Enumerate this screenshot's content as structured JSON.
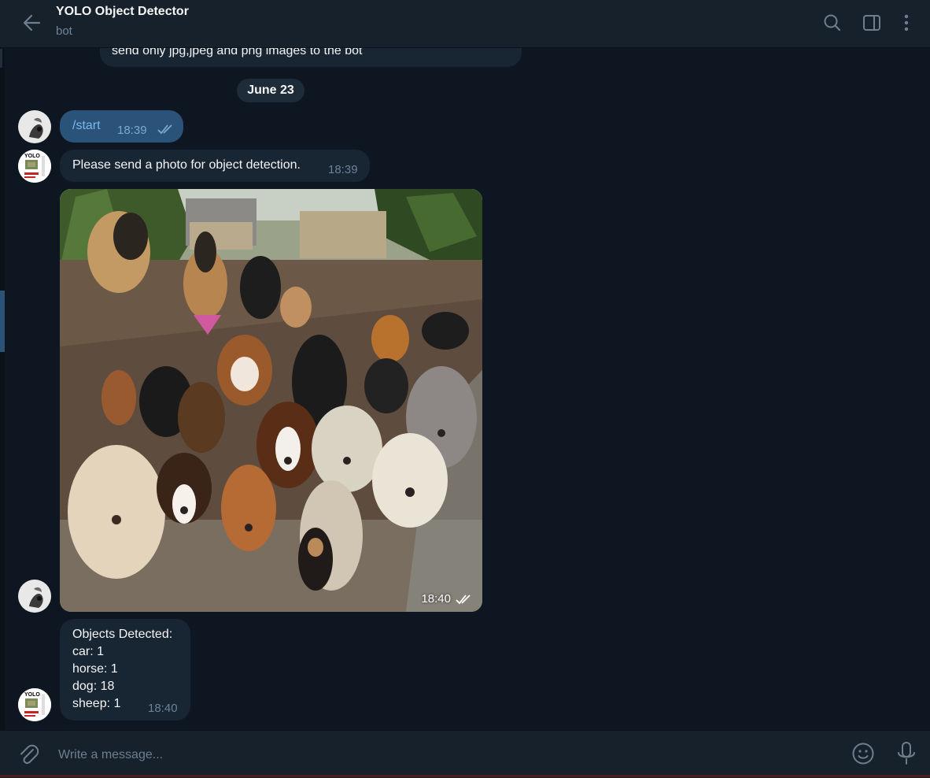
{
  "header": {
    "title": "YOLO Object Detector",
    "subtitle": "bot"
  },
  "messages": {
    "previous_text": "send only jpg,jpeg and png images to the bot",
    "date_separator": "June 23",
    "user_start": {
      "text": "/start",
      "time": "18:39"
    },
    "bot_prompt": {
      "text": "Please send a photo for object detection.",
      "time": "18:39"
    },
    "user_photo": {
      "time": "18:40"
    },
    "bot_result": {
      "title": "Objects Detected:",
      "lines": [
        "car: 1",
        "horse: 1",
        "dog: 18",
        "sheep: 1"
      ],
      "time": "18:40"
    }
  },
  "avatars": {
    "bot_logo_text": "YOLO"
  },
  "composer": {
    "placeholder": "Write a message..."
  },
  "colors": {
    "background": "#0e1621",
    "header": "#17212b",
    "incoming_bubble": "#182533",
    "outgoing_bubble": "#2b5278",
    "accent": "#5ea5e6"
  }
}
